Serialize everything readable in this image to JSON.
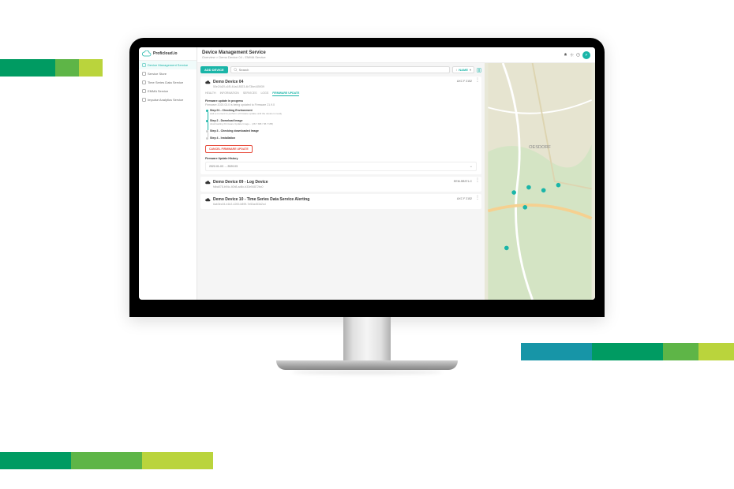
{
  "brand": {
    "name": "Proficloud.io"
  },
  "sidebar": {
    "items": [
      {
        "icon": "device",
        "label": "Device Management Service",
        "active": true
      },
      {
        "icon": "cart",
        "label": "Service Store"
      },
      {
        "icon": "chart",
        "label": "Time Series Data Service"
      },
      {
        "icon": "gauge",
        "label": "EMMA Service"
      },
      {
        "icon": "analytics",
        "label": "Impulse Analytics Service"
      }
    ]
  },
  "header": {
    "title": "Device Management Service",
    "breadcrumb": "Overview > Demo Device 04 - EMMA Service",
    "avatar_initial": "P"
  },
  "toolbar": {
    "add_label": "ADD DEVICE",
    "search_placeholder": "Search",
    "sort_label": "NAME"
  },
  "tabs": [
    "HEALTH",
    "INFORMATION",
    "SERVICES",
    "LOGS",
    "FIRMWARE UPDATE"
  ],
  "active_tab": 4,
  "device_main": {
    "name": "Demo Device 04",
    "id": "50e24d2f-c1f5-44a4-8523-4b73be445939",
    "type": "AXC F 2152"
  },
  "firmware": {
    "heading": "Firmware update in progress",
    "sub": "Firmware 2020.03.0 is being updated to Firmware 21.9.0",
    "steps": [
      {
        "t": "Step 01 - Checking Environment",
        "d": "wait a moment to perform a firmware update until the device is ready",
        "done": true
      },
      {
        "t": "Step 2 - Download Image",
        "d": "downloading Firmware Update Image... (28.7 MB / 58.7 MB)",
        "done": true
      },
      {
        "t": "Step 3 - Checking downloaded Image",
        "d": "",
        "done": false
      },
      {
        "t": "Step 4 - Installation",
        "d": "",
        "done": false
      }
    ],
    "cancel_label": "CANCEL FIRMWARE UPDATE",
    "history_heading": "Firmware Update History",
    "history_item": "2022-01-03 → 2020.03"
  },
  "devices": [
    {
      "name": "Demo Device 09 - Log Device",
      "id": "fdba578-b94c-40b8-ad6c-b33e54872bc0",
      "type": "EEM-SB371-C"
    },
    {
      "name": "Demo Device 10 - Time Series Data Service Alerting",
      "id": "6ab3ec04-b1b2-4200-b899-7e53a453d2cd",
      "type": "AXC F 2152"
    }
  ],
  "map": {
    "label": "OESDORF"
  },
  "stripes": {
    "colors": [
      "#009b62",
      "#5eb547",
      "#bad43c",
      "#1795a7"
    ]
  }
}
